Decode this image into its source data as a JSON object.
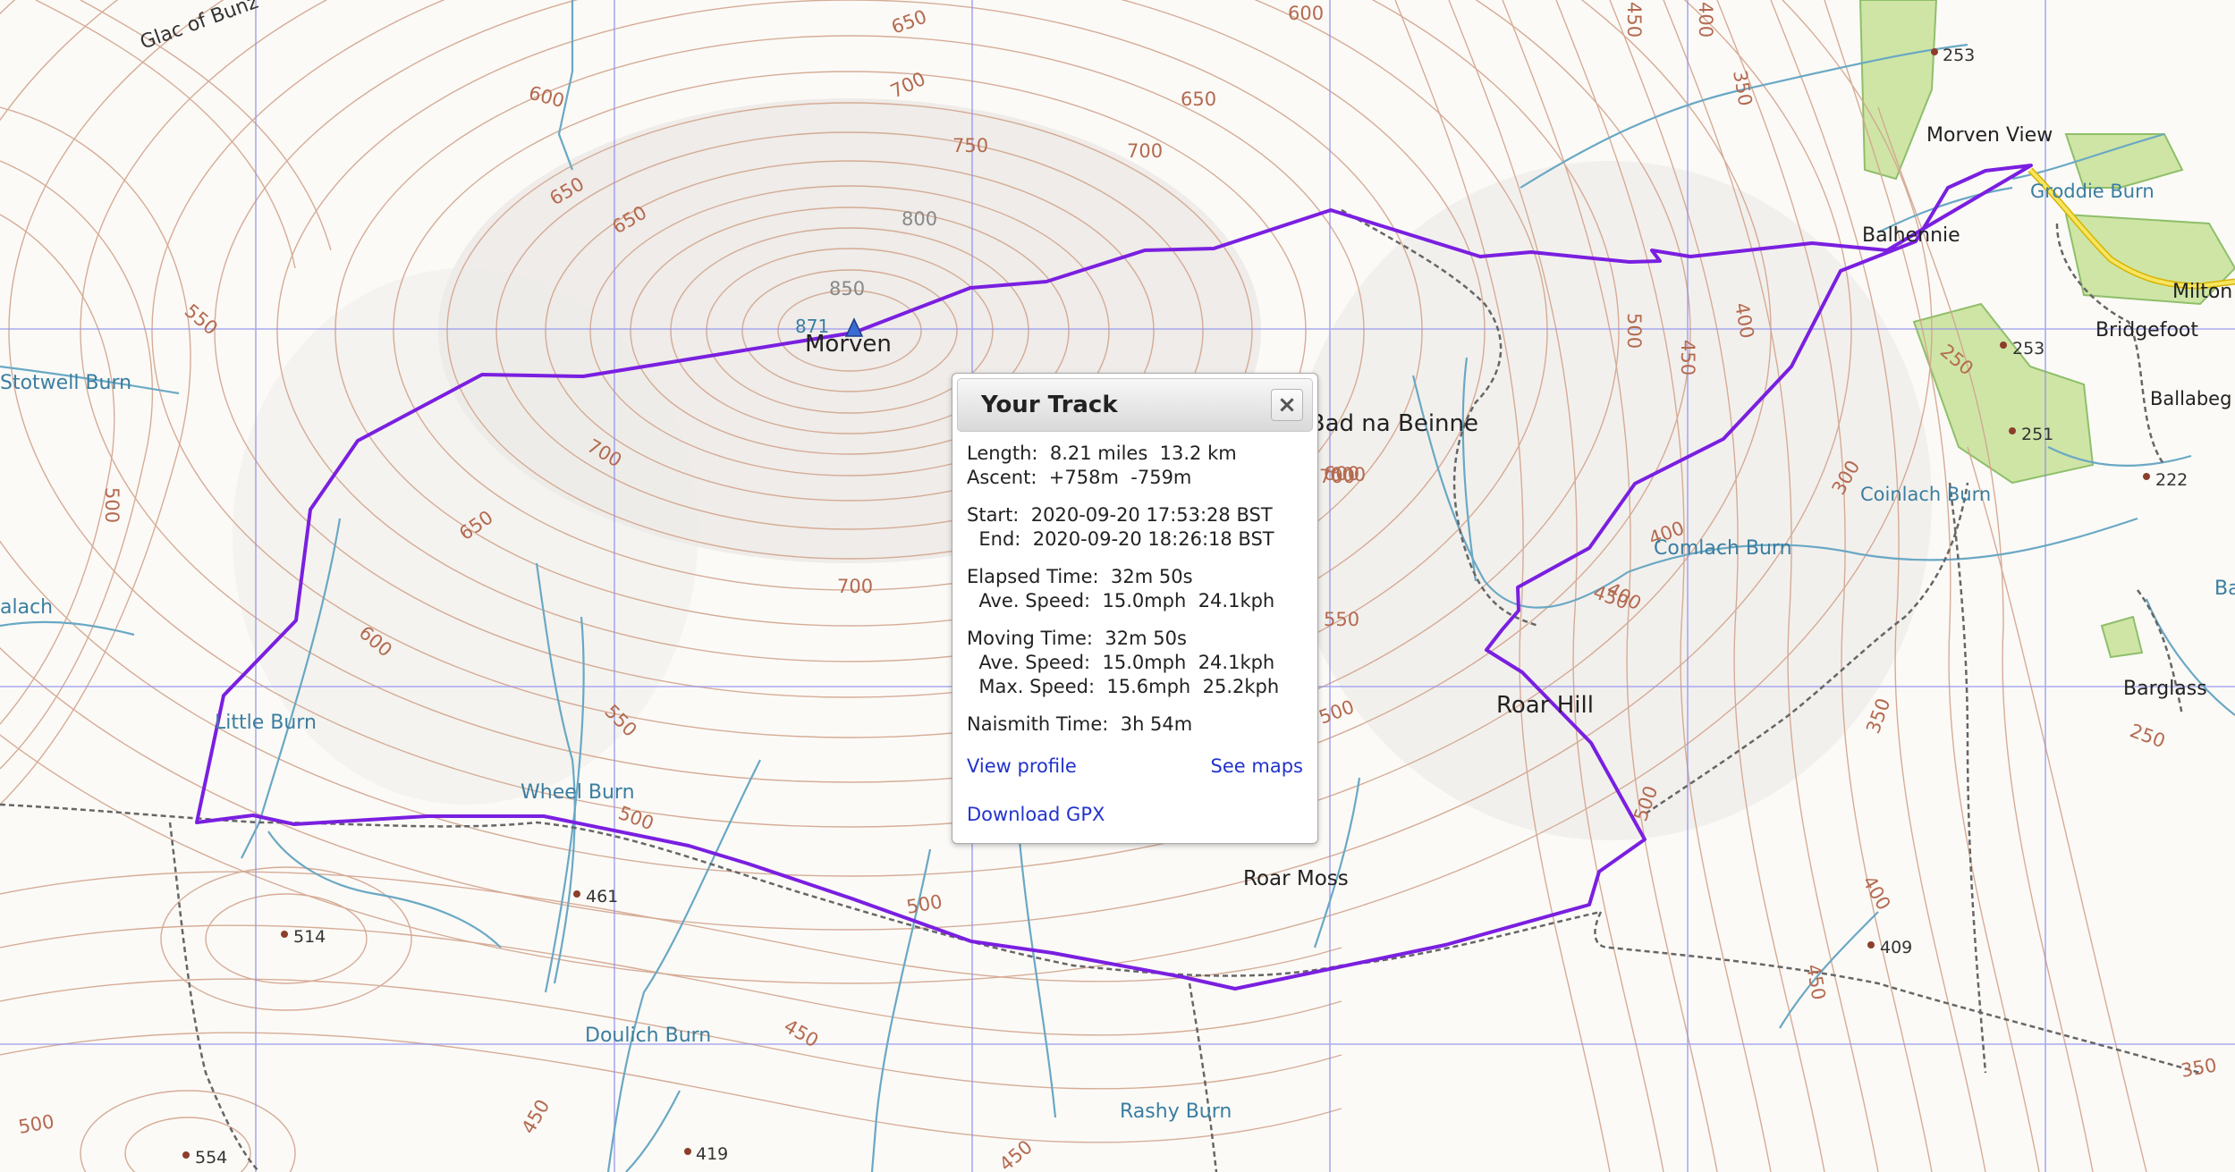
{
  "map": {
    "places": [
      {
        "name": "Glac of Bunz"
      },
      {
        "name": "Morven"
      },
      {
        "name": "Bad na Beinne"
      },
      {
        "name": "Stotwell Burn"
      },
      {
        "name": "Little Burn"
      },
      {
        "name": "Wheel Burn"
      },
      {
        "name": "Roar Hill"
      },
      {
        "name": "Roar Moss"
      },
      {
        "name": "Doulich Burn"
      },
      {
        "name": "Rashy Burn"
      },
      {
        "name": "Morven View"
      },
      {
        "name": "Groddie Burn"
      },
      {
        "name": "Balhennie"
      },
      {
        "name": "Milton"
      },
      {
        "name": "Bridgefoot"
      },
      {
        "name": "Ballabeg"
      },
      {
        "name": "Coinlach Burn"
      },
      {
        "name": "Comlach Burn"
      },
      {
        "name": "Barglass"
      },
      {
        "name": "alach"
      },
      {
        "name": "Ba"
      }
    ],
    "summit": {
      "height": "871",
      "name": "Morven"
    },
    "spot_heights": [
      "253",
      "253",
      "251",
      "222",
      "461",
      "514",
      "554",
      "419",
      "409"
    ],
    "contour_labels": [
      "650",
      "600",
      "600",
      "650",
      "700",
      "750",
      "700",
      "650",
      "800",
      "850",
      "650",
      "700",
      "550",
      "500",
      "700",
      "650",
      "600",
      "550",
      "700",
      "550",
      "500",
      "500",
      "450",
      "450",
      "500",
      "500",
      "450",
      "400",
      "450",
      "500",
      "350",
      "400",
      "450",
      "400",
      "300",
      "250",
      "350",
      "250",
      "400",
      "450",
      "350",
      "500",
      "450",
      "400",
      "600",
      "600"
    ]
  },
  "popup": {
    "title": "Your Track",
    "close_icon": "×",
    "length_label": "Length:",
    "length_miles": "8.21 miles",
    "length_km": "13.2 km",
    "ascent_label": "Ascent:",
    "ascent_up": "+758m",
    "ascent_down": "-759m",
    "start_label": "Start:",
    "start_value": "2020-09-20 17:53:28 BST",
    "end_label": "End:",
    "end_value": "2020-09-20 18:26:18 BST",
    "elapsed_label": "Elapsed Time:",
    "elapsed_value": "32m 50s",
    "elapsed_speed_label": "Ave. Speed:",
    "elapsed_speed_mph": "15.0mph",
    "elapsed_speed_kph": "24.1kph",
    "moving_label": "Moving Time:",
    "moving_value": "32m 50s",
    "moving_ave_label": "Ave. Speed:",
    "moving_ave_mph": "15.0mph",
    "moving_ave_kph": "24.1kph",
    "moving_max_label": "Max. Speed:",
    "moving_max_mph": "15.6mph",
    "moving_max_kph": "25.2kph",
    "naismith_label": "Naismith Time:",
    "naismith_value": "3h 54m",
    "view_profile": "View profile",
    "see_maps": "See maps",
    "download_gpx": "Download GPX"
  },
  "colors": {
    "track": "#7a1fe0",
    "grid": "#8f8ff0",
    "contour": "#d2a48d",
    "water": "#6aa8c4",
    "woodland": "#cfe5a6"
  }
}
